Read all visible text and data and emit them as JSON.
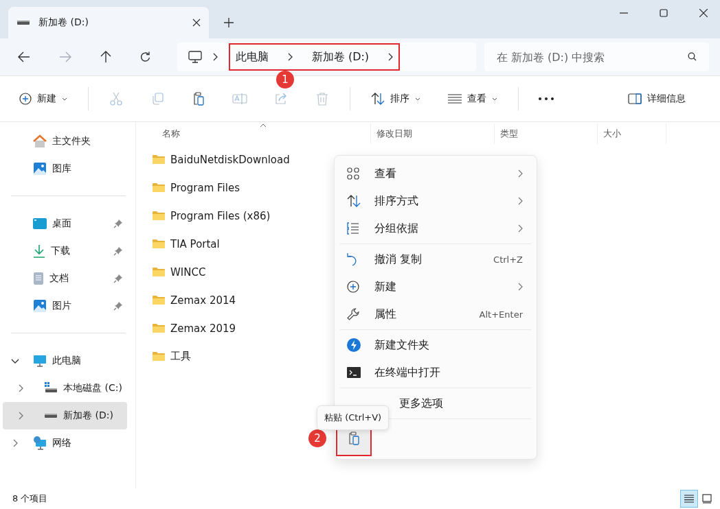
{
  "tab": {
    "title": "新加卷 (D:)"
  },
  "breadcrumb": [
    "此电脑",
    "新加卷 (D:)"
  ],
  "search": {
    "placeholder": "在 新加卷 (D:) 中搜索"
  },
  "toolbar": [
    {
      "kind": "new",
      "label": "新建"
    },
    {
      "kind": "cut",
      "disabled": true
    },
    {
      "kind": "copy",
      "disabled": true
    },
    {
      "kind": "paste",
      "disabled": false
    },
    {
      "kind": "rename",
      "disabled": true
    },
    {
      "kind": "share",
      "disabled": true
    },
    {
      "kind": "delete",
      "disabled": true
    },
    {
      "kind": "sort",
      "label": "排序"
    },
    {
      "kind": "view",
      "label": "查看"
    },
    {
      "kind": "more"
    }
  ],
  "details_button": {
    "label": "详细信息"
  },
  "sidebar": [
    [
      {
        "label": "主文件夹",
        "pinned": false,
        "selected": false
      },
      {
        "label": "图库",
        "pinned": false,
        "selected": false
      }
    ],
    [
      {
        "label": "桌面",
        "pinned": true,
        "selected": false
      },
      {
        "label": "下载",
        "pinned": true,
        "selected": false
      },
      {
        "label": "文档",
        "pinned": true,
        "selected": false
      },
      {
        "label": "图片",
        "pinned": true,
        "selected": false
      }
    ],
    [
      {
        "label": "此电脑",
        "expanded": true,
        "selected": false,
        "children": [
          {
            "label": "本地磁盘 (C:)",
            "expanded": false,
            "selected": false
          },
          {
            "label": "新加卷 (D:)",
            "expanded": false,
            "selected": true
          }
        ]
      },
      {
        "label": "网络",
        "expanded": false,
        "selected": false
      }
    ]
  ],
  "columns": [
    {
      "label": "名称",
      "sorted": true
    },
    {
      "label": "修改日期",
      "sorted": false
    },
    {
      "label": "类型",
      "sorted": false
    },
    {
      "label": "大小",
      "sorted": false
    }
  ],
  "files": [
    "BaiduNetdiskDownload",
    "Program Files",
    "Program Files (x86)",
    "TIA Portal",
    "WINCC",
    "Zemax 2014",
    "Zemax 2019",
    "工具"
  ],
  "context_menu": {
    "sections": [
      [
        {
          "label": "查看",
          "submenu": true
        },
        {
          "label": "排序方式",
          "submenu": true
        },
        {
          "label": "分组依据",
          "submenu": true
        }
      ],
      [
        {
          "label": "撤消 复制",
          "shortcut": "Ctrl+Z",
          "submenu": false
        },
        {
          "label": "新建",
          "submenu": true
        },
        {
          "label": "属性",
          "shortcut": "Alt+Enter",
          "submenu": false
        }
      ],
      [
        {
          "label": "新建文件夹",
          "submenu": false
        },
        {
          "label": "在终端中打开",
          "submenu": false
        }
      ],
      [
        {
          "label": "更多选项",
          "submenu": false
        }
      ]
    ],
    "tooltip": "粘贴 (Ctrl+V)"
  },
  "status_bar": {
    "count": "8 个项目",
    "views": [
      {
        "kind": "details",
        "selected": true
      },
      {
        "kind": "tiles",
        "selected": false
      }
    ]
  },
  "annotations": [
    "1",
    "2"
  ]
}
